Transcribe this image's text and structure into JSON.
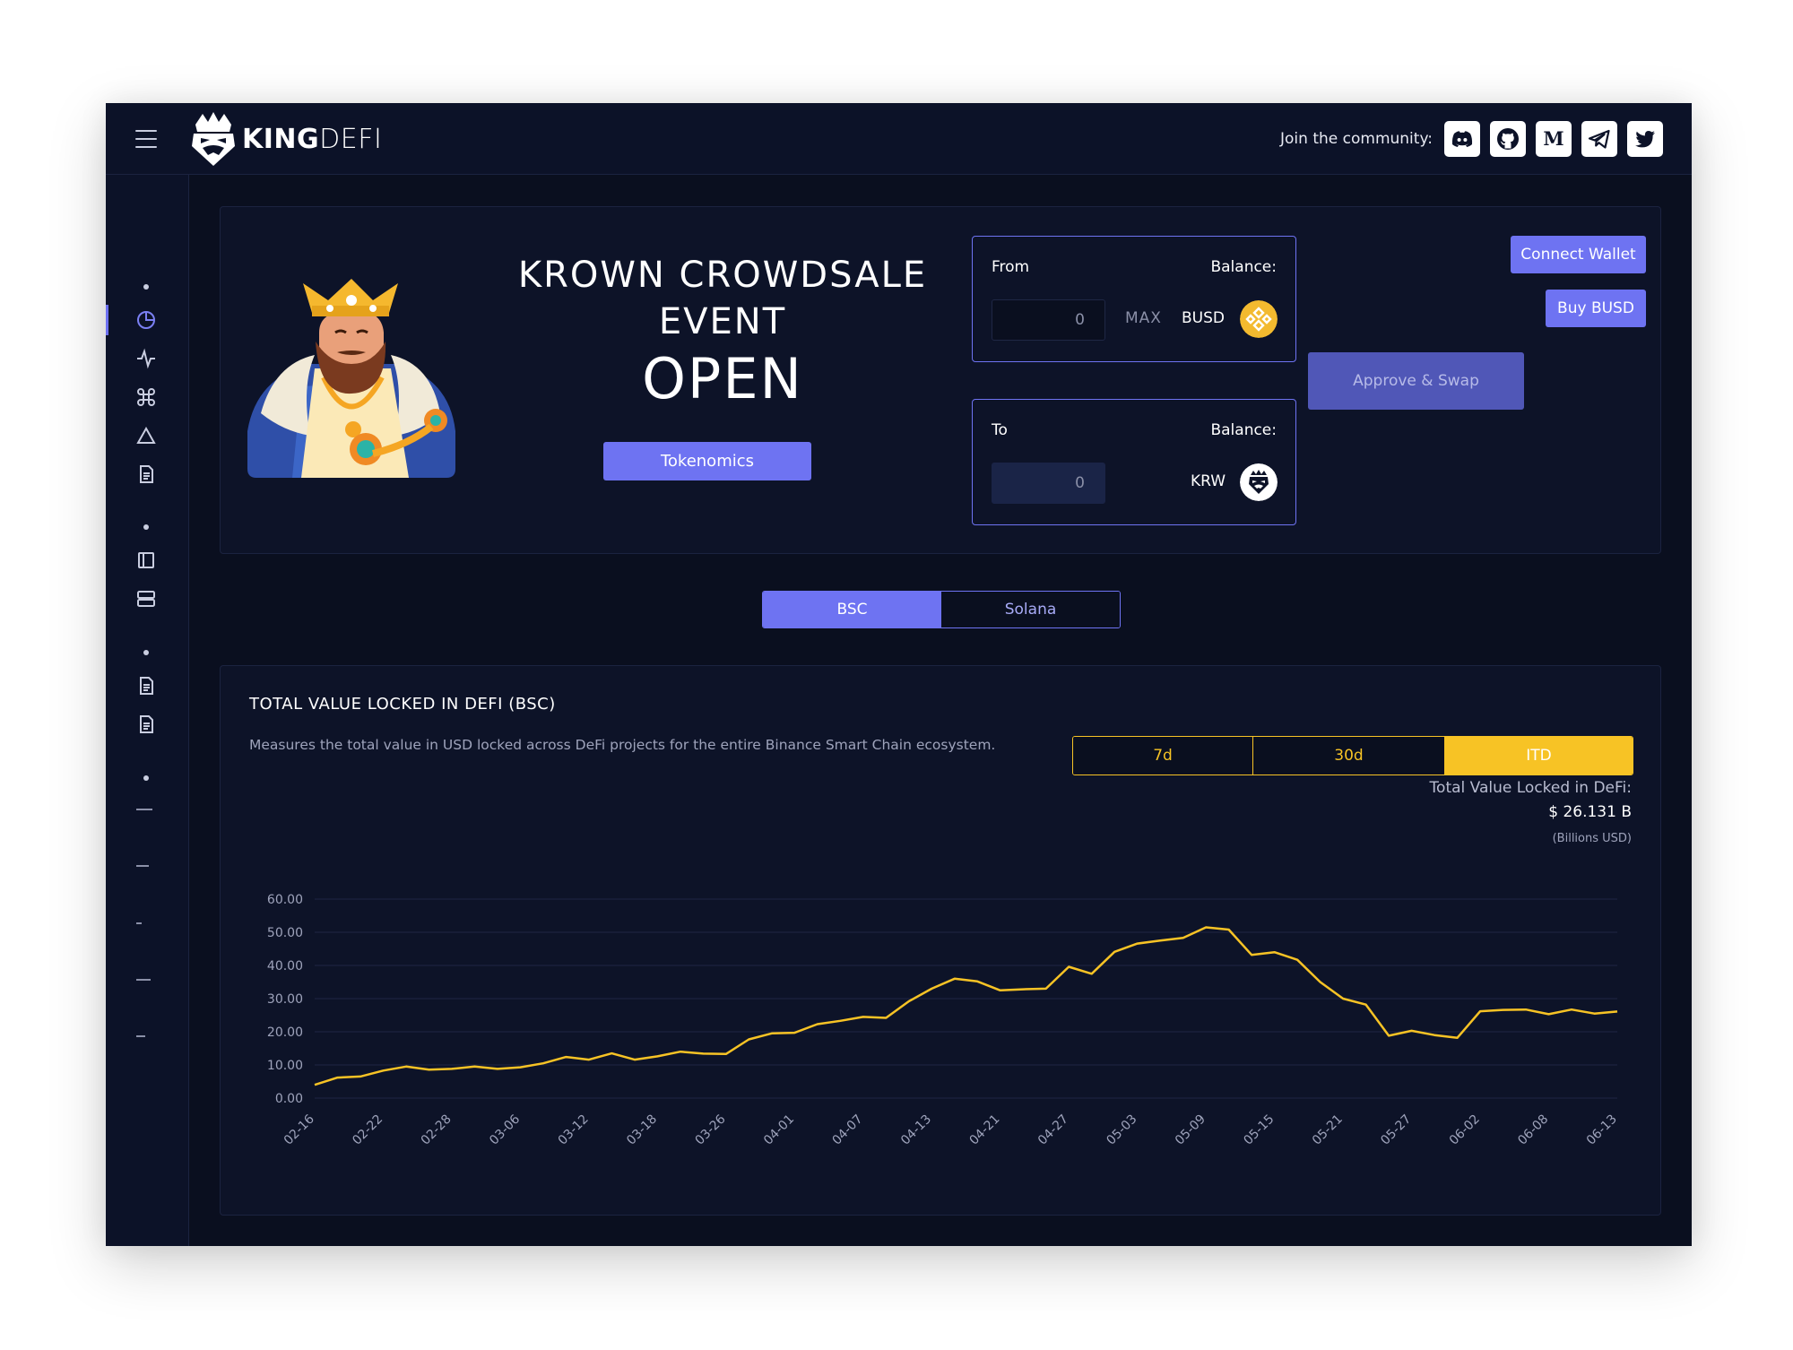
{
  "header": {
    "logo_bold": "KING",
    "logo_light": "DEFI",
    "community_label": "Join the community:",
    "social": [
      "discord-icon",
      "github-icon",
      "medium-icon",
      "telegram-icon",
      "twitter-icon"
    ]
  },
  "hero": {
    "title_line1": "KROWN CROWDSALE",
    "title_line2": "EVENT",
    "status": "OPEN",
    "tokenomics_label": "Tokenomics",
    "from": {
      "label": "From",
      "balance_label": "Balance:",
      "input_value": "0",
      "max_label": "MAX",
      "token": "BUSD"
    },
    "to": {
      "label": "To",
      "balance_label": "Balance:",
      "input_value": "0",
      "token": "KRW"
    },
    "approve_label": "Approve & Swap",
    "connect_label": "Connect Wallet",
    "buy_label": "Buy BUSD"
  },
  "network": {
    "options": [
      "BSC",
      "Solana"
    ],
    "selected": "BSC"
  },
  "tvl": {
    "title": "TOTAL VALUE LOCKED IN DEFI (BSC)",
    "description": "Measures the total value in USD locked across DeFi projects for the entire Binance Smart Chain ecosystem.",
    "ranges": [
      "7d",
      "30d",
      "ITD"
    ],
    "selected_range": "ITD",
    "summary_label": "Total Value Locked in DeFi:",
    "summary_value": "$ 26.131 B",
    "summary_unit": "(Billions USD)"
  },
  "colors": {
    "accent": "#6e73f2",
    "gold": "#f7c325",
    "background": "#0a0f1f",
    "card": "#0d1328"
  },
  "chart_data": {
    "type": "line",
    "ylim": [
      0,
      60
    ],
    "y_ticks": [
      "0.00",
      "10.00",
      "20.00",
      "30.00",
      "40.00",
      "50.00",
      "60.00"
    ],
    "x_tick_labels": [
      "02-16",
      "02-22",
      "02-28",
      "03-06",
      "03-12",
      "03-18",
      "03-26",
      "04-01",
      "04-07",
      "04-13",
      "04-21",
      "04-27",
      "05-03",
      "05-09",
      "05-15",
      "05-21",
      "05-27",
      "06-02",
      "06-08",
      "06-13"
    ],
    "grid": true,
    "series": [
      {
        "color": "#f7c325",
        "values": [
          4.0,
          6.2,
          6.5,
          8.3,
          9.5,
          8.6,
          8.8,
          9.5,
          8.8,
          9.3,
          10.5,
          12.4,
          11.6,
          13.5,
          11.6,
          12.6,
          14.0,
          13.4,
          13.3,
          17.7,
          19.5,
          19.7,
          22.3,
          23.3,
          24.5,
          24.2,
          29.2,
          33.0,
          36.0,
          35.2,
          32.5,
          32.8,
          33.0,
          39.6,
          37.5,
          44.1,
          46.6,
          47.5,
          48.3,
          51.5,
          50.8,
          43.2,
          44.0,
          41.7,
          35.0,
          30.0,
          28.2,
          18.8,
          20.3,
          19.0,
          18.2,
          26.2,
          26.6,
          26.7,
          25.3,
          26.7,
          25.5,
          26.1
        ]
      }
    ]
  }
}
